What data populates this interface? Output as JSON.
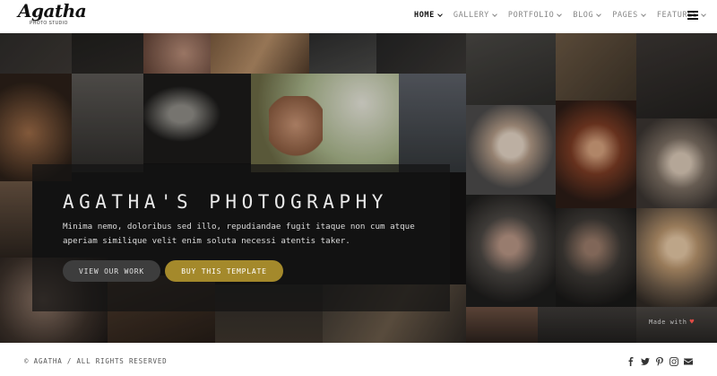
{
  "brand": {
    "name": "Agatha",
    "tagline": "PHOTO STUDIO"
  },
  "nav": {
    "items": [
      {
        "label": "HOME",
        "active": true
      },
      {
        "label": "GALLERY",
        "active": false
      },
      {
        "label": "PORTFOLIO",
        "active": false
      },
      {
        "label": "BLOG",
        "active": false
      },
      {
        "label": "PAGES",
        "active": false
      },
      {
        "label": "FEATURES",
        "active": false
      }
    ],
    "menu_icon": "hamburger-icon"
  },
  "hero": {
    "title": "AGATHA'S PHOTOGRAPHY",
    "description": "Minima nemo, doloribus sed illo, repudiandae fugit itaque non cum atque aperiam similique velit enim soluta necessi atentis taker.",
    "primary_button": "VIEW OUR WORK",
    "secondary_button": "BUY THIS TEMPLATE",
    "made_with": "Made with",
    "heart_icon": "heart-icon"
  },
  "footer": {
    "copyright": "© AGATHA / ALL RIGHTS RESERVED",
    "socials": [
      "facebook-icon",
      "twitter-icon",
      "pinterest-icon",
      "instagram-icon",
      "email-icon"
    ]
  },
  "colors": {
    "accent_gold": "#a4892b",
    "heart": "#e14b45",
    "active_nav": "#111111",
    "nav": "#888888"
  }
}
